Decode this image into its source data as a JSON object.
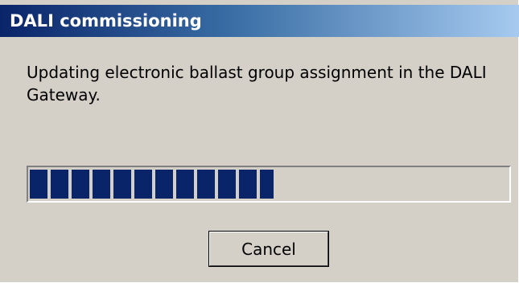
{
  "window": {
    "title": "DALI commissioning"
  },
  "message": "Updating electronic ballast group assignment in the DALI Gateway.",
  "progress": {
    "value_percent": 51,
    "fill_color": "#0a246a"
  },
  "buttons": {
    "cancel_label": "Cancel"
  },
  "colors": {
    "dialog_background": "#d4d0c8",
    "title_gradient_start": "#0a246a",
    "title_gradient_end": "#a6caf0"
  }
}
